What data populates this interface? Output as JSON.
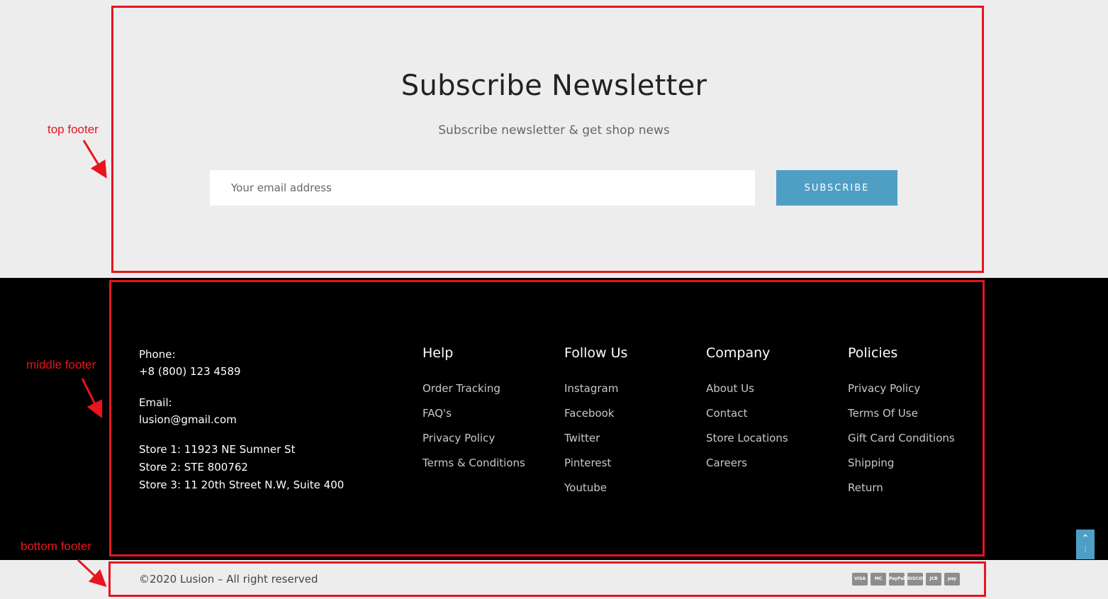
{
  "newsletter": {
    "title": "Subscribe Newsletter",
    "subtitle": "Subscribe newsletter & get shop news",
    "email_placeholder": "Your email address",
    "button_label": "SUBSCRIBE"
  },
  "contact": {
    "phone_label": "Phone:",
    "phone": "+8 (800) 123 4589",
    "email_label": "Email:",
    "email": "lusion@gmail.com",
    "stores": [
      "Store 1: 11923 NE Sumner St",
      "Store 2: STE 800762",
      "Store 3: 11 20th Street N.W, Suite 400"
    ]
  },
  "columns": [
    {
      "title": "Help",
      "links": [
        "Order Tracking",
        "FAQ's",
        "Privacy Policy",
        "Terms & Conditions"
      ]
    },
    {
      "title": "Follow Us",
      "links": [
        "Instagram",
        "Facebook",
        "Twitter",
        "Pinterest",
        "Youtube"
      ]
    },
    {
      "title": "Company",
      "links": [
        "About Us",
        "Contact",
        "Store Locations",
        "Careers"
      ]
    },
    {
      "title": "Policies",
      "links": [
        "Privacy Policy",
        "Terms Of Use",
        "Gift Card Conditions",
        "Shipping",
        "Return"
      ]
    }
  ],
  "bottom": {
    "copyright": "©2020 Lusion – All right reserved",
    "payments": [
      "VISA",
      "MC",
      "PayPal",
      "DISCOVER",
      "JCB",
      "pay"
    ]
  },
  "scroll_top_icon": "chevron-up-icon",
  "annotations": {
    "top": "top footer",
    "middle": "middle footer",
    "bottom": "bottom footer"
  },
  "colors": {
    "accent": "#4f9fc4",
    "annotation": "#e8141e",
    "light_bg": "#ededee",
    "dark_bg": "#000000"
  }
}
